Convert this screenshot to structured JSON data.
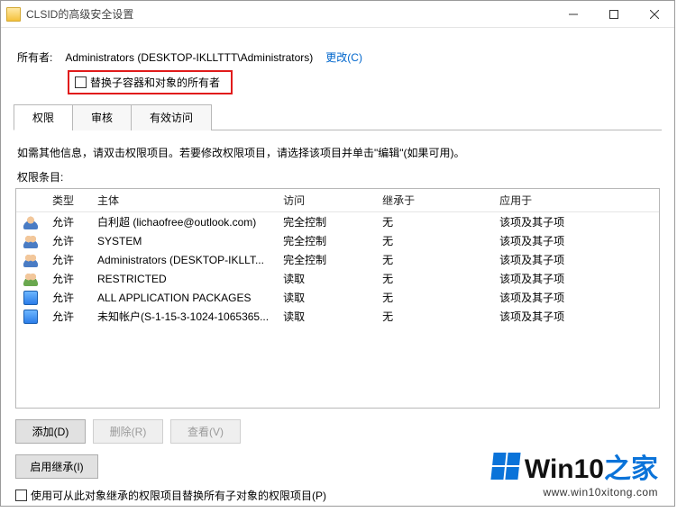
{
  "window": {
    "title": "CLSID的高级安全设置"
  },
  "owner": {
    "label": "所有者:",
    "value": "Administrators (DESKTOP-IKLLTTT\\Administrators)",
    "change_link": "更改(C)"
  },
  "replace_owner_checkbox_label": "替换子容器和对象的所有者",
  "tabs": [
    {
      "label": "权限",
      "active": true
    },
    {
      "label": "审核",
      "active": false
    },
    {
      "label": "有效访问",
      "active": false
    }
  ],
  "instructions": "如需其他信息，请双击权限项目。若要修改权限项目，请选择该项目并单击\"编辑\"(如果可用)。",
  "perm_entries_label": "权限条目:",
  "columns": {
    "type": "类型",
    "principal": "主体",
    "access": "访问",
    "inherit": "继承于",
    "apply": "应用于"
  },
  "rows": [
    {
      "icon": "user",
      "type": "允许",
      "principal": "白利超 (lichaofree@outlook.com)",
      "access": "完全控制",
      "inherit": "无",
      "apply": "该项及其子项"
    },
    {
      "icon": "users",
      "type": "允许",
      "principal": "SYSTEM",
      "access": "完全控制",
      "inherit": "无",
      "apply": "该项及其子项"
    },
    {
      "icon": "users",
      "type": "允许",
      "principal": "Administrators (DESKTOP-IKLLT...",
      "access": "完全控制",
      "inherit": "无",
      "apply": "该项及其子项"
    },
    {
      "icon": "restricted",
      "type": "允许",
      "principal": "RESTRICTED",
      "access": "读取",
      "inherit": "无",
      "apply": "该项及其子项"
    },
    {
      "icon": "package",
      "type": "允许",
      "principal": "ALL APPLICATION PACKAGES",
      "access": "读取",
      "inherit": "无",
      "apply": "该项及其子项"
    },
    {
      "icon": "package",
      "type": "允许",
      "principal": "未知帐户(S-1-15-3-1024-1065365...",
      "access": "读取",
      "inherit": "无",
      "apply": "该项及其子项"
    }
  ],
  "buttons": {
    "add": "添加(D)",
    "remove": "删除(R)",
    "view": "查看(V)",
    "enable_inherit": "启用继承(I)"
  },
  "replace_all_label": "使用可从此对象继承的权限项目替换所有子对象的权限项目(P)",
  "watermark": {
    "prefix": "Win10",
    "suffix": "之家",
    "url": "www.win10xitong.com"
  }
}
